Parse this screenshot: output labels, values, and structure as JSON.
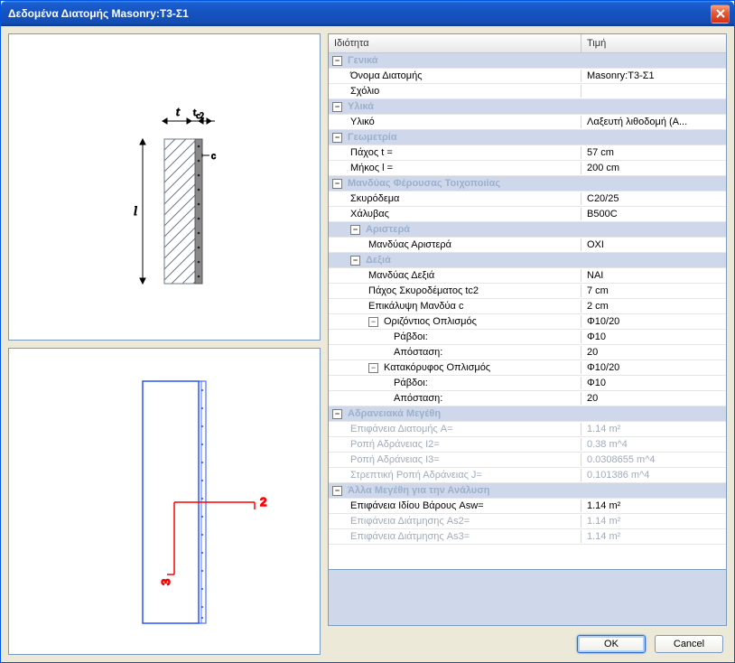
{
  "window": {
    "title": "Δεδομένα Διατομής Masonry:T3-Σ1"
  },
  "headers": {
    "property": "Ιδιότητα",
    "value": "Τιμή"
  },
  "buttons": {
    "ok": "OK",
    "cancel": "Cancel"
  },
  "groups": {
    "general": "Γενικά",
    "material": "Υλικά",
    "geometry": "Γεωμετρία",
    "jacket": "Μανδύας Φέρουσας Τοιχοποιίας",
    "left": "Αριστερά",
    "right": "Δεξιά",
    "horiz": "Οριζόντιος Οπλισμός",
    "vert": "Κατακόρυφος Οπλισμός",
    "inertia": "Αδρανειακά Μεγέθη",
    "other": "Άλλα Μεγέθη για την Ανάλυση"
  },
  "props": {
    "section_name": {
      "label": "Όνομα Διατομής",
      "value": "Masonry:T3-Σ1"
    },
    "comment": {
      "label": "Σχόλιο",
      "value": ""
    },
    "material": {
      "label": "Υλικό",
      "value": "Λαξευτή λιθοδομή (Α..."
    },
    "thickness": {
      "label": "Πάχος t =",
      "value": "57 cm"
    },
    "length": {
      "label": "Μήκος l =",
      "value": "200 cm"
    },
    "concrete": {
      "label": "Σκυρόδεμα",
      "value": "C20/25"
    },
    "steel": {
      "label": "Χάλυβας",
      "value": "B500C"
    },
    "jacket_left": {
      "label": "Μανδύας Αριστερά",
      "value": "ΟΧΙ"
    },
    "jacket_right": {
      "label": "Μανδύας Δεξιά",
      "value": "ΝΑΙ"
    },
    "tc2": {
      "label": "Πάχος Σκυροδέματος tc2",
      "value": "7 cm"
    },
    "cover_c": {
      "label": "Επικάλυψη Μανδύα c",
      "value": "2 cm"
    },
    "horiz_sum": {
      "value": "Φ10/20"
    },
    "horiz_bars": {
      "label": "Ράβδοι:",
      "value": "Φ10"
    },
    "horiz_spacing": {
      "label": "Απόσταση:",
      "value": "20"
    },
    "vert_sum": {
      "value": "Φ10/20"
    },
    "vert_bars": {
      "label": "Ράβδοι:",
      "value": "Φ10"
    },
    "vert_spacing": {
      "label": "Απόσταση:",
      "value": "20"
    },
    "area": {
      "label": "Επιφάνεια Διατομής A=",
      "value": "1.14 m²"
    },
    "i2": {
      "label": "Ροπή Αδράνειας I2=",
      "value": "0.38 m^4"
    },
    "i3": {
      "label": "Ροπή Αδράνειας I3=",
      "value": "0.0308655 m^4"
    },
    "j": {
      "label": "Στρεπτική Ροπή Αδράνειας J=",
      "value": "0.101386 m^4"
    },
    "asw": {
      "label": "Επιφάνεια Ιδίου Βάρους Asw=",
      "value": "1.14 m²"
    },
    "as2": {
      "label": "Επιφάνεια Διάτμησης As2=",
      "value": "1.14 m²"
    },
    "as3": {
      "label": "Επιφάνεια Διάτμησης As3=",
      "value": "1.14 m²"
    }
  },
  "diagram1": {
    "t": "t",
    "tc2": "tc2",
    "c": "c",
    "l": "l"
  },
  "diagram2": {
    "axis2": "2",
    "axis3": "3"
  }
}
